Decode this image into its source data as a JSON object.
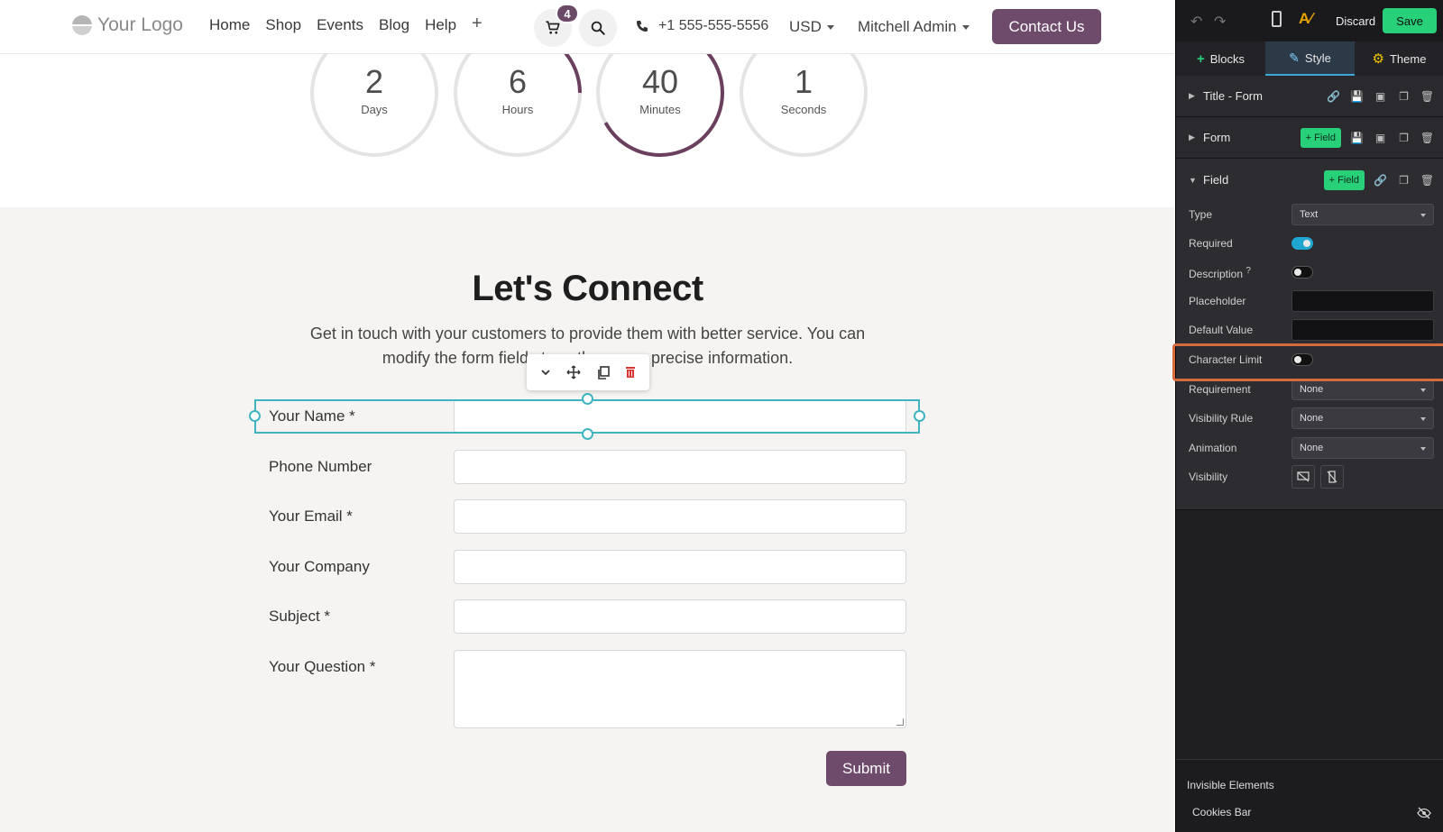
{
  "header": {
    "logo_text": "Your Logo",
    "nav": [
      "Home",
      "Shop",
      "Events",
      "Blog",
      "Help"
    ],
    "nav_add": "+",
    "cart_count": "4",
    "phone": "+1 555-555-5556",
    "currency": "USD",
    "user": "Mitchell Admin",
    "contact_button": "Contact Us"
  },
  "countdown": [
    {
      "value": "2",
      "label": "Days",
      "fraction": 0.0
    },
    {
      "value": "6",
      "label": "Hours",
      "fraction": 0.25
    },
    {
      "value": "40",
      "label": "Minutes",
      "fraction": 0.67
    },
    {
      "value": "1",
      "label": "Seconds",
      "fraction": 0.0
    }
  ],
  "section": {
    "title": "Let's Connect",
    "subtitle_line1": "Get in touch with your customers to provide them with better service. You can",
    "subtitle_line2": "modify the form fields to gather more precise information."
  },
  "form": {
    "fields": [
      {
        "label": "Your Name *"
      },
      {
        "label": "Phone Number"
      },
      {
        "label": "Your Email *"
      },
      {
        "label": "Your Company"
      },
      {
        "label": "Subject *"
      },
      {
        "label": "Your Question *"
      }
    ],
    "submit": "Submit"
  },
  "panel": {
    "discard": "Discard",
    "save": "Save",
    "tabs": [
      "Blocks",
      "Style",
      "Theme"
    ],
    "active_tab": "Style",
    "sections": [
      {
        "name": "Title - Form"
      },
      {
        "name": "Form",
        "add_label": "+ Field"
      },
      {
        "name": "Field",
        "add_label": "+ Field"
      }
    ],
    "options": {
      "type_label": "Type",
      "type_value": "Text",
      "required_label": "Required",
      "required_on": true,
      "description_label": "Description",
      "description_help": "?",
      "description_on": false,
      "placeholder_label": "Placeholder",
      "default_value_label": "Default Value",
      "char_limit_label": "Character Limit",
      "char_limit_on": false,
      "requirement_label": "Requirement",
      "requirement_value": "None",
      "visibility_rule_label": "Visibility Rule",
      "visibility_rule_value": "None",
      "animation_label": "Animation",
      "animation_value": "None",
      "visibility_label": "Visibility"
    },
    "invisible_title": "Invisible Elements",
    "invisible_items": [
      "Cookies Bar"
    ]
  },
  "colors": {
    "brand": "#6e4a6b",
    "editor_accent": "#29d07a",
    "selection": "#3fb4c0",
    "highlight": "#d56a3c"
  }
}
